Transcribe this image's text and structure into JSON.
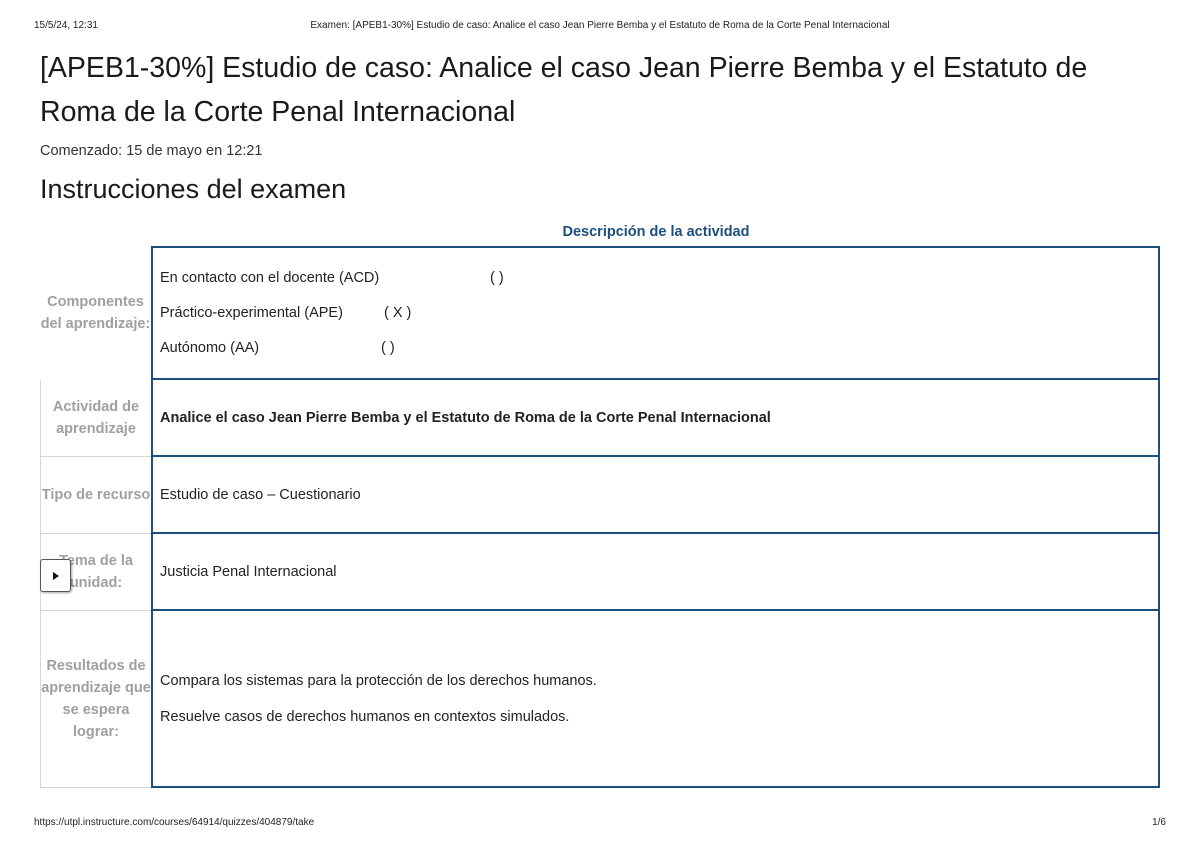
{
  "print_header": {
    "datetime": "15/5/24, 12:31",
    "title": "Examen: [APEB1-30%] Estudio de caso: Analice el caso Jean Pierre Bemba y el Estatuto de Roma de la Corte Penal Internacional"
  },
  "page": {
    "title": "[APEB1-30%] Estudio de caso: Analice el caso Jean Pierre Bemba y el Estatuto de Roma de la Corte Penal Internacional",
    "started": "Comenzado: 15 de mayo en 12:21",
    "section_title": "Instrucciones del examen"
  },
  "table": {
    "caption": "Descripción de la actividad",
    "rows": [
      {
        "label": "Componentes del aprendizaje:",
        "components": [
          {
            "name": "En contacto con el docente (ACD)",
            "mark": "(   )"
          },
          {
            "name": "Práctico-experimental (APE)",
            "mark": "(  X )"
          },
          {
            "name": "Autónomo (AA)",
            "mark": "(     )"
          }
        ]
      },
      {
        "label": "Actividad de aprendizaje",
        "value": "Analice el caso Jean Pierre Bemba y el Estatuto de Roma de la Corte Penal Internacional"
      },
      {
        "label": "Tipo de recurso",
        "value": "Estudio de caso – Cuestionario"
      },
      {
        "label": "Tema de la unidad:",
        "value": "Justicia Penal Internacional"
      },
      {
        "label": "Resultados de aprendizaje que se espera lograr:",
        "values": [
          "Compara los sistemas para la protección de los derechos humanos.",
          "Resuelve casos de derechos humanos en contextos simulados."
        ]
      }
    ]
  },
  "collapse_button": {
    "icon": "triangle-right-icon"
  },
  "print_footer": {
    "url": "https://utpl.instructure.com/courses/64914/quizzes/404879/take",
    "page_num": "1/6"
  }
}
